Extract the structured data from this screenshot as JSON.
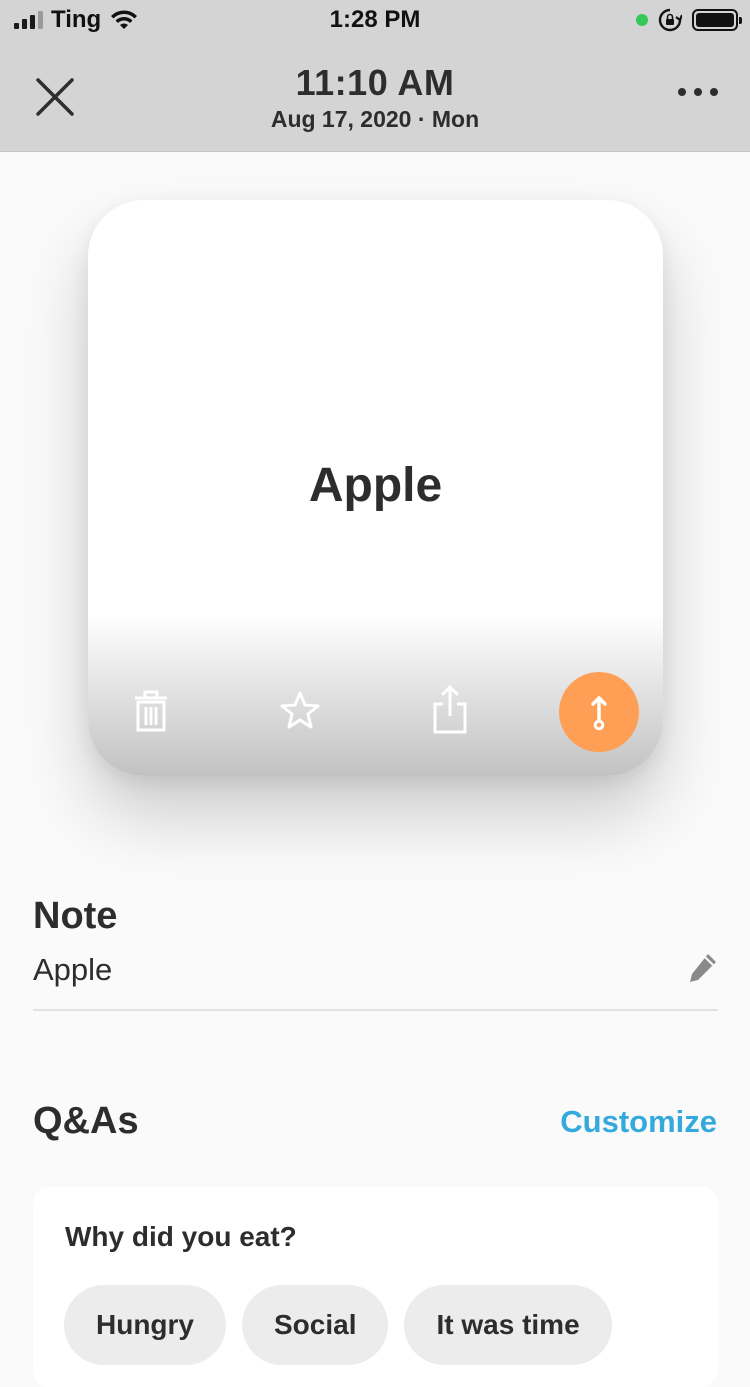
{
  "status_bar": {
    "carrier": "Ting",
    "time": "1:28 PM",
    "battery_level": 1.0
  },
  "header": {
    "time": "11:10 AM",
    "date": "Aug 17, 2020 · Mon",
    "close_icon": "close-icon",
    "more_icon": "more-horizontal-icon"
  },
  "card": {
    "title": "Apple",
    "actions": [
      "trash-icon",
      "star-icon",
      "share-icon",
      "timeline-icon"
    ],
    "accent_color": "#fe9f55"
  },
  "note": {
    "heading": "Note",
    "text": "Apple",
    "edit_icon": "pencil-icon"
  },
  "qa": {
    "heading": "Q&As",
    "customize_label": "Customize",
    "link_color": "#33a9dd",
    "question": "Why did you eat?",
    "options": [
      "Hungry",
      "Social",
      "It was time"
    ]
  }
}
